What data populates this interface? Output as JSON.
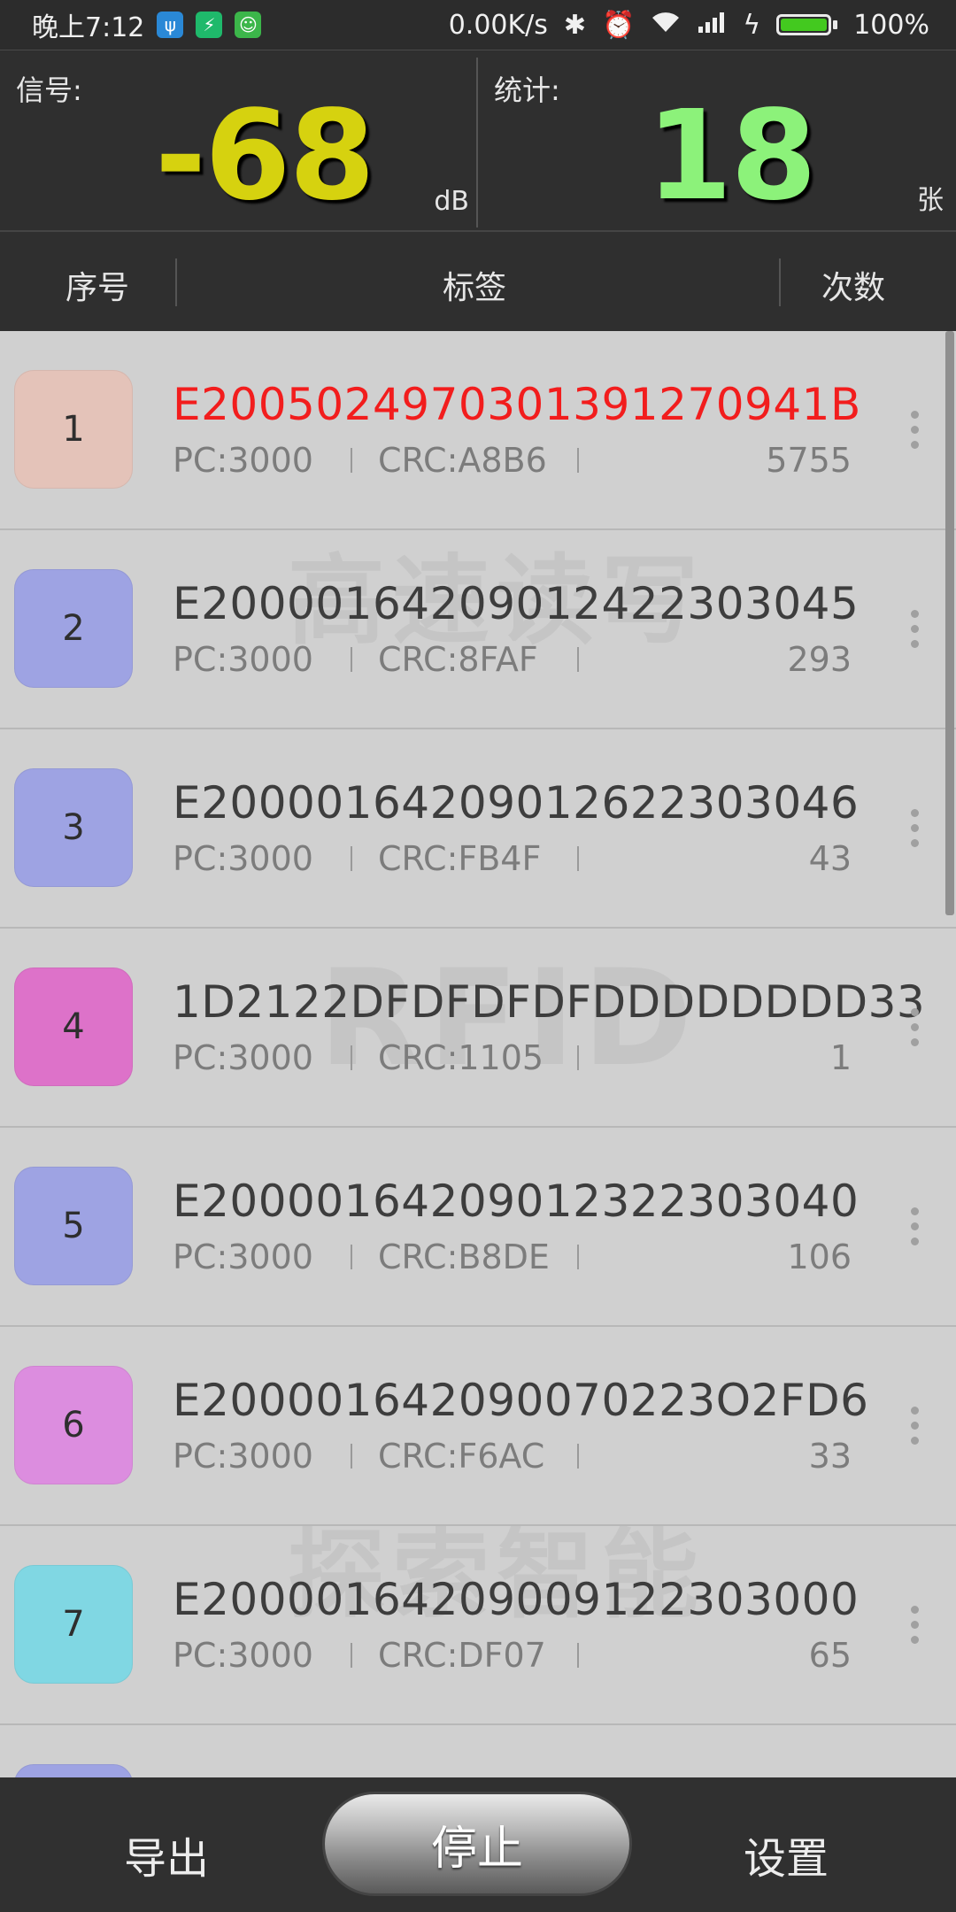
{
  "status_bar": {
    "time": "晚上7:12",
    "net_speed": "0.00K/s",
    "battery": "100%"
  },
  "signal": {
    "label": "信号:",
    "value": "-68",
    "unit": "dB"
  },
  "stats": {
    "label": "统计:",
    "value": "18",
    "unit": "张"
  },
  "columns": {
    "seq": "序号",
    "tag": "标签",
    "count": "次数"
  },
  "rows": [
    {
      "index": "1",
      "epc": "E2005024970301391270941B",
      "pc": "PC:3000",
      "crc": "CRC:A8B6",
      "count": "5755",
      "color": "#e4c3b9",
      "highlight": true
    },
    {
      "index": "2",
      "epc": "E20000164209012422303045",
      "pc": "PC:3000",
      "crc": "CRC:8FAF",
      "count": "293",
      "color": "#9ea3e3",
      "highlight": false
    },
    {
      "index": "3",
      "epc": "E20000164209012622303046",
      "pc": "PC:3000",
      "crc": "CRC:FB4F",
      "count": "43",
      "color": "#9ea3e3",
      "highlight": false
    },
    {
      "index": "4",
      "epc": "1D2122DFDFDFDFDDDDDDDD33",
      "pc": "PC:3000",
      "crc": "CRC:1105",
      "count": "1",
      "color": "#dd72c9",
      "highlight": false
    },
    {
      "index": "5",
      "epc": "E20000164209012322303040",
      "pc": "PC:3000",
      "crc": "CRC:B8DE",
      "count": "106",
      "color": "#9ea3e3",
      "highlight": false
    },
    {
      "index": "6",
      "epc": "E200001642090070223O2FD6",
      "pc": "PC:3000",
      "crc": "CRC:F6AC",
      "count": "33",
      "color": "#dc8ddf",
      "highlight": false
    },
    {
      "index": "7",
      "epc": "E20000164209009122303000",
      "pc": "PC:3000",
      "crc": "CRC:DF07",
      "count": "65",
      "color": "#80d7e3",
      "highlight": false
    }
  ],
  "watermarks": [
    "高速读写",
    "RFID",
    "探索智能"
  ],
  "bottom": {
    "export": "导出",
    "stop": "停止",
    "settings": "设置"
  }
}
